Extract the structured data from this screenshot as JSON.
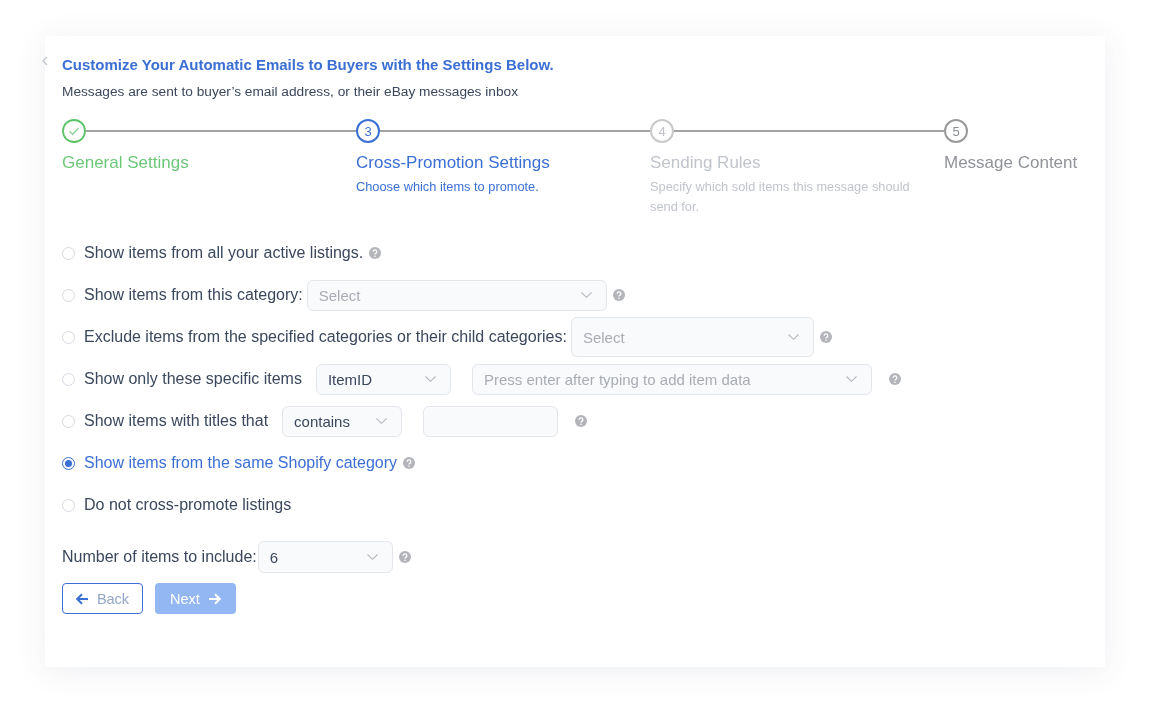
{
  "header": {
    "title": "Customize Your Automatic Emails to Buyers with the Settings Below.",
    "subtitle": "Messages are sent to buyer’s email address, or their eBay messages inbox"
  },
  "steps": [
    {
      "title": "General Settings",
      "completed": true,
      "active": false,
      "disabled": false
    },
    {
      "number": "3",
      "title": "Cross-Promotion Settings",
      "description": "Choose which items to promote.",
      "completed": false,
      "active": true,
      "disabled": false
    },
    {
      "number": "4",
      "title": "Sending Rules",
      "description": "Specify which sold items this message should send for.",
      "completed": false,
      "active": false,
      "disabled": true
    },
    {
      "number": "5",
      "title": "Message Content",
      "completed": false,
      "active": false,
      "disabled": false
    }
  ],
  "options": [
    {
      "label": "Show items from all your active listings.",
      "selected": false,
      "help": true
    },
    {
      "label": "Show items from this category:",
      "selected": false,
      "controls": [
        {
          "kind": "select",
          "placeholder": "Select"
        }
      ],
      "help": true
    },
    {
      "label": "Exclude items from the specified categories or their child categories:",
      "selected": false,
      "controls": [
        {
          "kind": "select",
          "placeholder": "Select"
        }
      ],
      "help": true
    },
    {
      "label": "Show only these specific items",
      "selected": false,
      "controls": [
        {
          "kind": "select",
          "value": "ItemID"
        },
        {
          "kind": "tag-select",
          "placeholder": "Press enter after typing to add item data"
        }
      ],
      "help": true
    },
    {
      "label": "Show items with titles that",
      "selected": false,
      "controls": [
        {
          "kind": "select",
          "value": "contains"
        },
        {
          "kind": "input"
        }
      ],
      "help": true
    },
    {
      "label": "Show items from the same Shopify category",
      "selected": true,
      "help": true
    },
    {
      "label": "Do not cross-promote listings",
      "selected": false,
      "help": false
    }
  ],
  "item_count": {
    "label": "Number of items to include:",
    "value": "6",
    "help": true
  },
  "buttons": [
    {
      "kind": "back",
      "label": "Back",
      "disabled": false
    },
    {
      "kind": "next",
      "label": "Next",
      "disabled": true
    }
  ]
}
